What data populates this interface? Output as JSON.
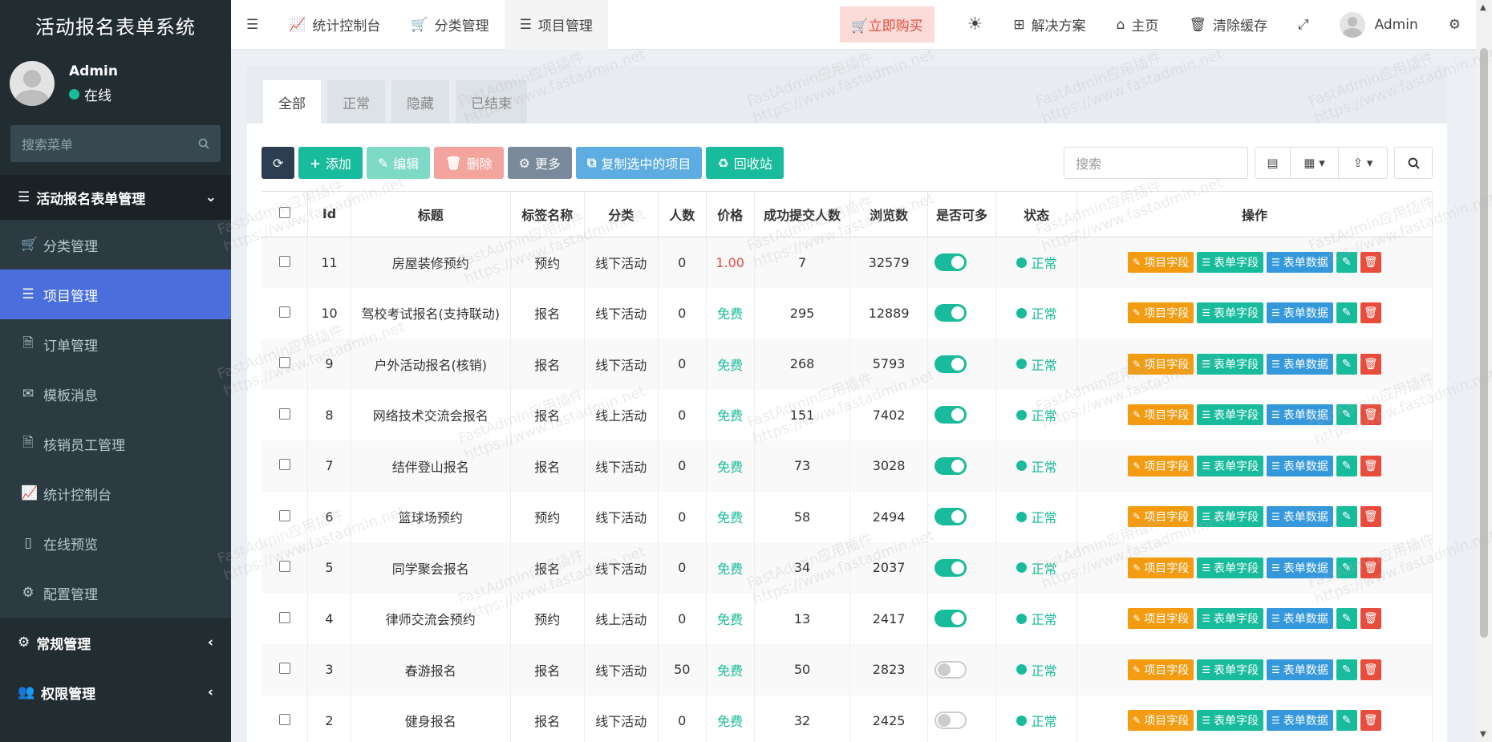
{
  "app": {
    "brand": "活动报名表单系统"
  },
  "user": {
    "name": "Admin",
    "status": "在线"
  },
  "sidebar": {
    "search_placeholder": "搜索菜单",
    "section": "活动报名表单管理",
    "items": [
      {
        "label": "分类管理",
        "icon": "cart-icon"
      },
      {
        "label": "项目管理",
        "icon": "list-icon",
        "active": true
      },
      {
        "label": "订单管理",
        "icon": "file-icon"
      },
      {
        "label": "模板消息",
        "icon": "mail-icon"
      },
      {
        "label": "核销员工管理",
        "icon": "file-icon"
      },
      {
        "label": "统计控制台",
        "icon": "chart-icon"
      },
      {
        "label": "在线预览",
        "icon": "mobile-icon"
      },
      {
        "label": "配置管理",
        "icon": "cogs-icon"
      }
    ],
    "groups": [
      {
        "label": "常规管理",
        "icon": "cogs-icon"
      },
      {
        "label": "权限管理",
        "icon": "users-icon"
      }
    ]
  },
  "topbar": {
    "tabs": [
      {
        "label": "统计控制台"
      },
      {
        "label": "分类管理"
      },
      {
        "label": "项目管理"
      }
    ],
    "buy": "立即购买",
    "solutions": "解决方案",
    "home": "主页",
    "clear_cache": "清除缓存",
    "admin": "Admin"
  },
  "filter_tabs": [
    "全部",
    "正常",
    "隐藏",
    "已结束"
  ],
  "toolbar": {
    "add": "添加",
    "edit": "编辑",
    "delete": "删除",
    "more": "更多",
    "copy": "复制选中的项目",
    "recycle": "回收站",
    "search_placeholder": "搜索"
  },
  "table": {
    "headers": [
      "Id",
      "标题",
      "标签名称",
      "分类",
      "人数",
      "价格",
      "成功提交人数",
      "浏览数",
      "是否可多",
      "状态",
      "操作"
    ],
    "op_labels": {
      "project_fields": "项目字段",
      "form_fields": "表单字段",
      "form_data": "表单数据"
    },
    "rows": [
      {
        "id": "11",
        "title": "房屋装修预约",
        "tag": "预约",
        "category": "线下活动",
        "people": "0",
        "price": "1.00",
        "price_color": "#e74c3c",
        "submitted": "7",
        "views": "32579",
        "multi": true,
        "status": "正常"
      },
      {
        "id": "10",
        "title": "驾校考试报名(支持联动)",
        "tag": "报名",
        "category": "线下活动",
        "people": "0",
        "price": "免费",
        "price_color": "#18bc9c",
        "submitted": "295",
        "views": "12889",
        "multi": true,
        "status": "正常"
      },
      {
        "id": "9",
        "title": "户外活动报名(核销)",
        "tag": "报名",
        "category": "线下活动",
        "people": "0",
        "price": "免费",
        "price_color": "#18bc9c",
        "submitted": "268",
        "views": "5793",
        "multi": true,
        "status": "正常"
      },
      {
        "id": "8",
        "title": "网络技术交流会报名",
        "tag": "报名",
        "category": "线上活动",
        "people": "0",
        "price": "免费",
        "price_color": "#18bc9c",
        "submitted": "151",
        "views": "7402",
        "multi": true,
        "status": "正常"
      },
      {
        "id": "7",
        "title": "结伴登山报名",
        "tag": "报名",
        "category": "线下活动",
        "people": "0",
        "price": "免费",
        "price_color": "#18bc9c",
        "submitted": "73",
        "views": "3028",
        "multi": true,
        "status": "正常"
      },
      {
        "id": "6",
        "title": "篮球场预约",
        "tag": "预约",
        "category": "线下活动",
        "people": "0",
        "price": "免费",
        "price_color": "#18bc9c",
        "submitted": "58",
        "views": "2494",
        "multi": true,
        "status": "正常"
      },
      {
        "id": "5",
        "title": "同学聚会报名",
        "tag": "报名",
        "category": "线下活动",
        "people": "0",
        "price": "免费",
        "price_color": "#18bc9c",
        "submitted": "34",
        "views": "2037",
        "multi": true,
        "status": "正常"
      },
      {
        "id": "4",
        "title": "律师交流会预约",
        "tag": "预约",
        "category": "线上活动",
        "people": "0",
        "price": "免费",
        "price_color": "#18bc9c",
        "submitted": "13",
        "views": "2417",
        "multi": true,
        "status": "正常"
      },
      {
        "id": "3",
        "title": "春游报名",
        "tag": "报名",
        "category": "线下活动",
        "people": "50",
        "price": "免费",
        "price_color": "#18bc9c",
        "submitted": "50",
        "views": "2823",
        "multi": false,
        "status": "正常"
      },
      {
        "id": "2",
        "title": "健身报名",
        "tag": "报名",
        "category": "线下活动",
        "people": "0",
        "price": "免费",
        "price_color": "#18bc9c",
        "submitted": "32",
        "views": "2425",
        "multi": false,
        "status": "正常"
      }
    ]
  },
  "watermark": {
    "line1": "FastAdmin应用插件",
    "line2": "https://www.fastadmin.net"
  },
  "colors": {
    "sidebar_bg": "#222d32",
    "active_menu": "#4a6fdc",
    "success": "#18bc9c",
    "danger": "#e74c3c",
    "warning": "#f39c12",
    "info": "#3498db"
  }
}
